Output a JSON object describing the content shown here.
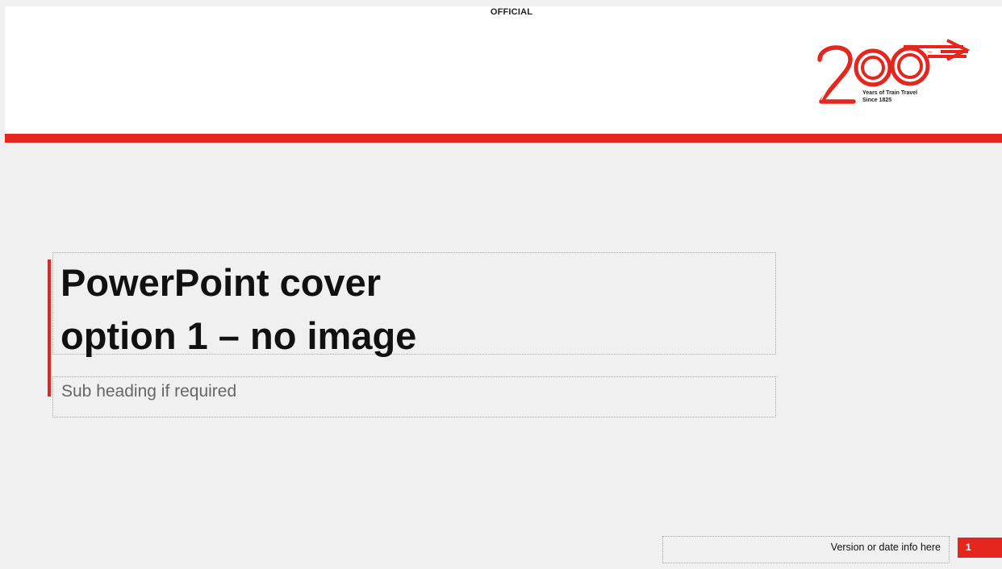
{
  "classification": "OFFICIAL",
  "logo": {
    "number": "200",
    "caption_line1": "Years of Train Travel",
    "caption_line2": "Since 1825"
  },
  "title_line1": "PowerPoint cover",
  "title_line2": "option 1 – no image",
  "subtitle": "Sub heading if required",
  "footer": "Version or date info here",
  "page_number": "1",
  "colors": {
    "accent": "#e5261f",
    "background": "#f0f0f0",
    "header": "#ffffff"
  }
}
